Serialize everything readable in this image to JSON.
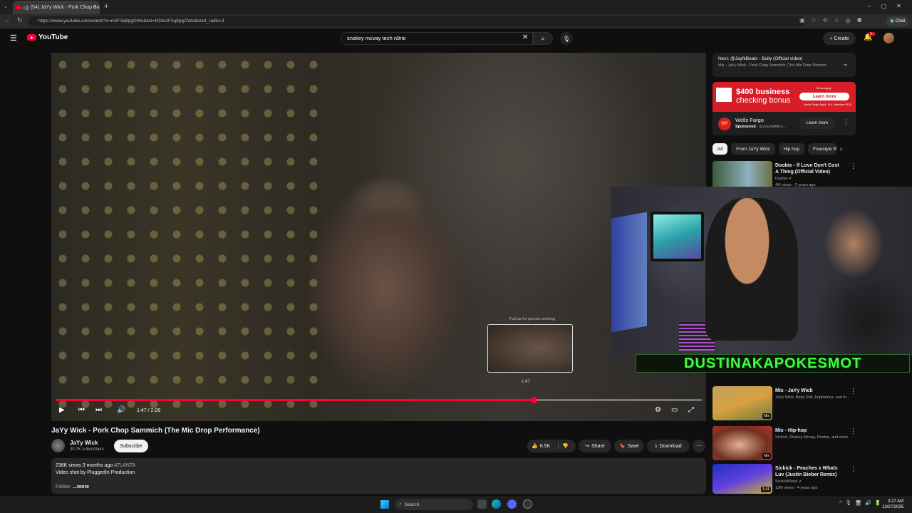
{
  "browser": {
    "tab_title": "(54) JaYy Wick - Pork Chop Sa",
    "url": "https://www.youtube.com/watch?v=m2F3q8pgOWo&list=RDm2F3q8pgOWo&start_radio=1",
    "chat_label": "Chat"
  },
  "header": {
    "logo_text": "YouTube",
    "search_value": "snakey mcvay tech n9ne",
    "create_label": "Create",
    "notif_count": "9+"
  },
  "player": {
    "pull_hint": "Pull up for precise seeking",
    "preview_time": "1:47",
    "time": "1:47 / 2:26",
    "progress": 0.74
  },
  "video": {
    "title": "JaYy Wick - Pork Chop Sammich (The Mic Drop Performance)",
    "channel": "JaYy Wick",
    "subscribers": "30.7K subscribers",
    "subscribe_label": "Subscribe",
    "likes": "6.5K",
    "share_label": "Share",
    "save_label": "Save",
    "download_label": "Download",
    "desc_stats": "236K views  3 months ago",
    "desc_tag": "ATLANTA",
    "desc_line": "Video shot by PluggedIn Production",
    "desc_follow": "Follow",
    "desc_more": "...more"
  },
  "sidebar": {
    "next_title": "Next: @JayfkBeats - Bully (Official video)",
    "next_sub": "Mix - JaYy Wick - Pork Chop Sammich (The Mic Drop Perform",
    "ad": {
      "headline": "$400 business",
      "headline2": "checking bonus",
      "cta": "Learn more",
      "terms": "Terms apply",
      "fdic": "Wells Fargo Bank, N.A. Member FDIC",
      "brand": "Wells Fargo",
      "sponsored": "Sponsored",
      "domain": "accountoffers...",
      "learn_more": "Learn more",
      "logo": "WF"
    },
    "chips": [
      "All",
      "From JaYy Wick",
      "Hip hop",
      "Freestyle R"
    ],
    "recs": [
      {
        "title": "Doobie - If Love Don't Cost A Thing (Official Video)",
        "channel": "Doobie",
        "meta": "4M views · 2 years ago"
      },
      {
        "title": "Mix - JaYy Wick",
        "channel": "JaYy Wick, Baby Drill, Enphamus, and m...",
        "meta": "",
        "badge": "Mix"
      },
      {
        "title": "Mix - Hip-hop",
        "channel": "Sickick, Shakey Mcvay, Doobie, and more",
        "meta": "",
        "badge": "Mix"
      },
      {
        "title": "Sickick - Peaches x Whats Luv (Justin Bieber Remix)",
        "channel": "SickickMusic",
        "meta": "12M views · 4 years ago",
        "badge": "1:41"
      }
    ]
  },
  "overlay": {
    "banner": "DUSTINAKAPOKESMOT"
  },
  "taskbar": {
    "search": "Search",
    "time": "3:27 AM",
    "date": "12/27/2025"
  }
}
